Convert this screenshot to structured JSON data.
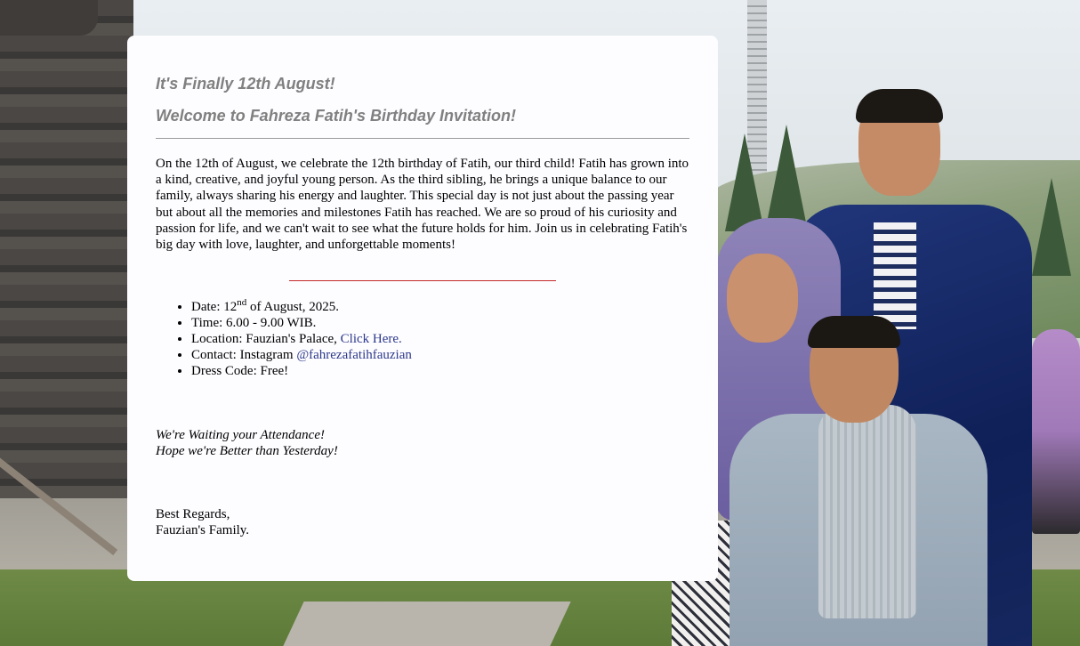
{
  "header": {
    "title_line1": "It's Finally 12th August!",
    "title_line2": "Welcome to Fahreza Fatih's Birthday Invitation!"
  },
  "intro": "On the 12th of August, we celebrate the 12th birthday of Fatih, our third child! Fatih has grown into a kind, creative, and joyful young person. As the third sibling, he brings a unique balance to our family, always sharing his energy and laughter. This special day is not just about the passing year but about all the memories and milestones Fatih has reached. We are so proud of his curiosity and passion for life, and we can't wait to see what the future holds for him. Join us in celebrating Fatih's big day with love, laughter, and unforgettable moments!",
  "details": {
    "date_prefix": "Date: 12",
    "date_sup": "nd",
    "date_suffix": " of August, 2025.",
    "time": "Time: 6.00 - 9.00 WIB.",
    "location_prefix": "Location: Fauzian's Palace, ",
    "location_link": "Click Here.",
    "contact_prefix": "Contact: Instagram ",
    "contact_link": "@fahrezafatihfauzian",
    "dress_code": "Dress Code: Free!"
  },
  "closing": {
    "line1": "We're Waiting your Attendance!",
    "line2": "Hope we're Better than Yesterday!"
  },
  "regards": {
    "line1": "Best Regards,",
    "line2": "Fauzian's Family."
  },
  "colors": {
    "heading": "#808080",
    "link": "#2d3a8c",
    "red_divider": "#c62a2a",
    "card_bg": "#fdfcff"
  }
}
